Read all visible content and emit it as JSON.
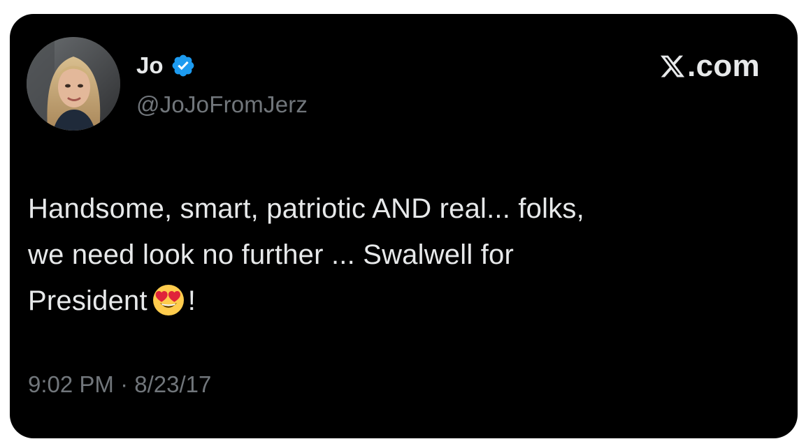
{
  "author": {
    "display_name": "Jo",
    "handle": "@JoJoFromJerz",
    "verified": true
  },
  "brand": {
    "domain": ".com",
    "icon": "x-logo-icon"
  },
  "tweet": {
    "line1": "Handsome, smart, patriotic AND real... folks,",
    "line2": "we need look no further ... Swalwell for",
    "line3_before_emoji": "President",
    "emoji": "heart-eyes-emoji-icon",
    "line3_after_emoji": "!"
  },
  "timestamp": "9:02 PM · 8/23/17",
  "colors": {
    "background": "#000000",
    "text": "#e7e9ea",
    "secondary_text": "#71767b",
    "verified_badge": "#1d9bf0"
  }
}
